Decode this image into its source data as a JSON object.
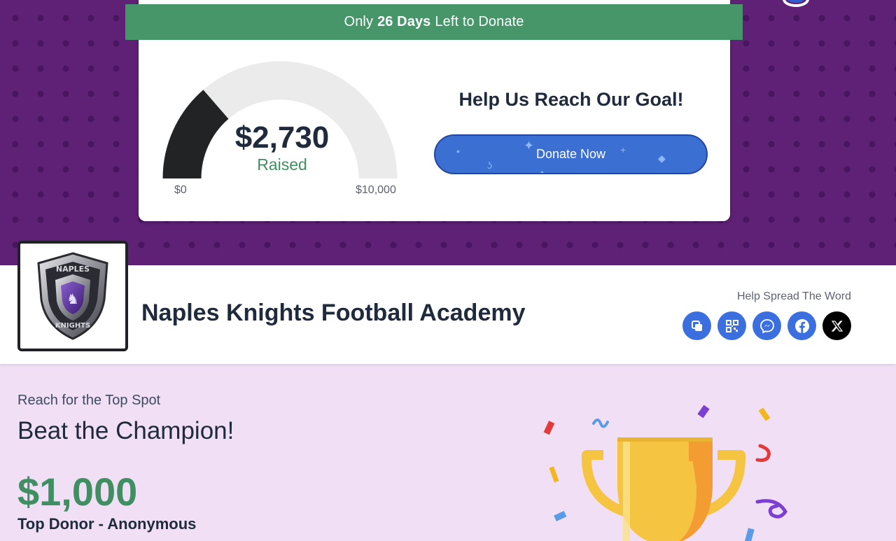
{
  "banner": {
    "prefix": "Only",
    "days": "26 Days",
    "suffix": "Left to Donate"
  },
  "gauge": {
    "raised": "$2,730",
    "raised_label": "Raised",
    "min_label": "$0",
    "max_label": "$10,000",
    "raised_value": 2730,
    "goal_value": 10000
  },
  "goal": {
    "title": "Help Us Reach Our Goal!",
    "donate_label": "Donate Now"
  },
  "org": {
    "name": "Naples Knights Football Academy",
    "logo_text_top": "NAPLES",
    "logo_text_bottom": "KNIGHTS"
  },
  "share": {
    "label": "Help Spread The Word",
    "buttons": [
      {
        "icon": "copy-icon"
      },
      {
        "icon": "qr-code-icon"
      },
      {
        "icon": "messenger-icon"
      },
      {
        "icon": "facebook-icon"
      },
      {
        "icon": "x-icon"
      }
    ]
  },
  "champion": {
    "subtitle": "Reach for the Top Spot",
    "title": "Beat the Champion!",
    "amount": "$1,000",
    "donor": "Top Donor - Anonymous"
  },
  "colors": {
    "hero_purple": "#5e2176",
    "accent_green": "#46966a",
    "donate_blue": "#3b6fd1",
    "section_lilac": "#f1e0f5"
  }
}
